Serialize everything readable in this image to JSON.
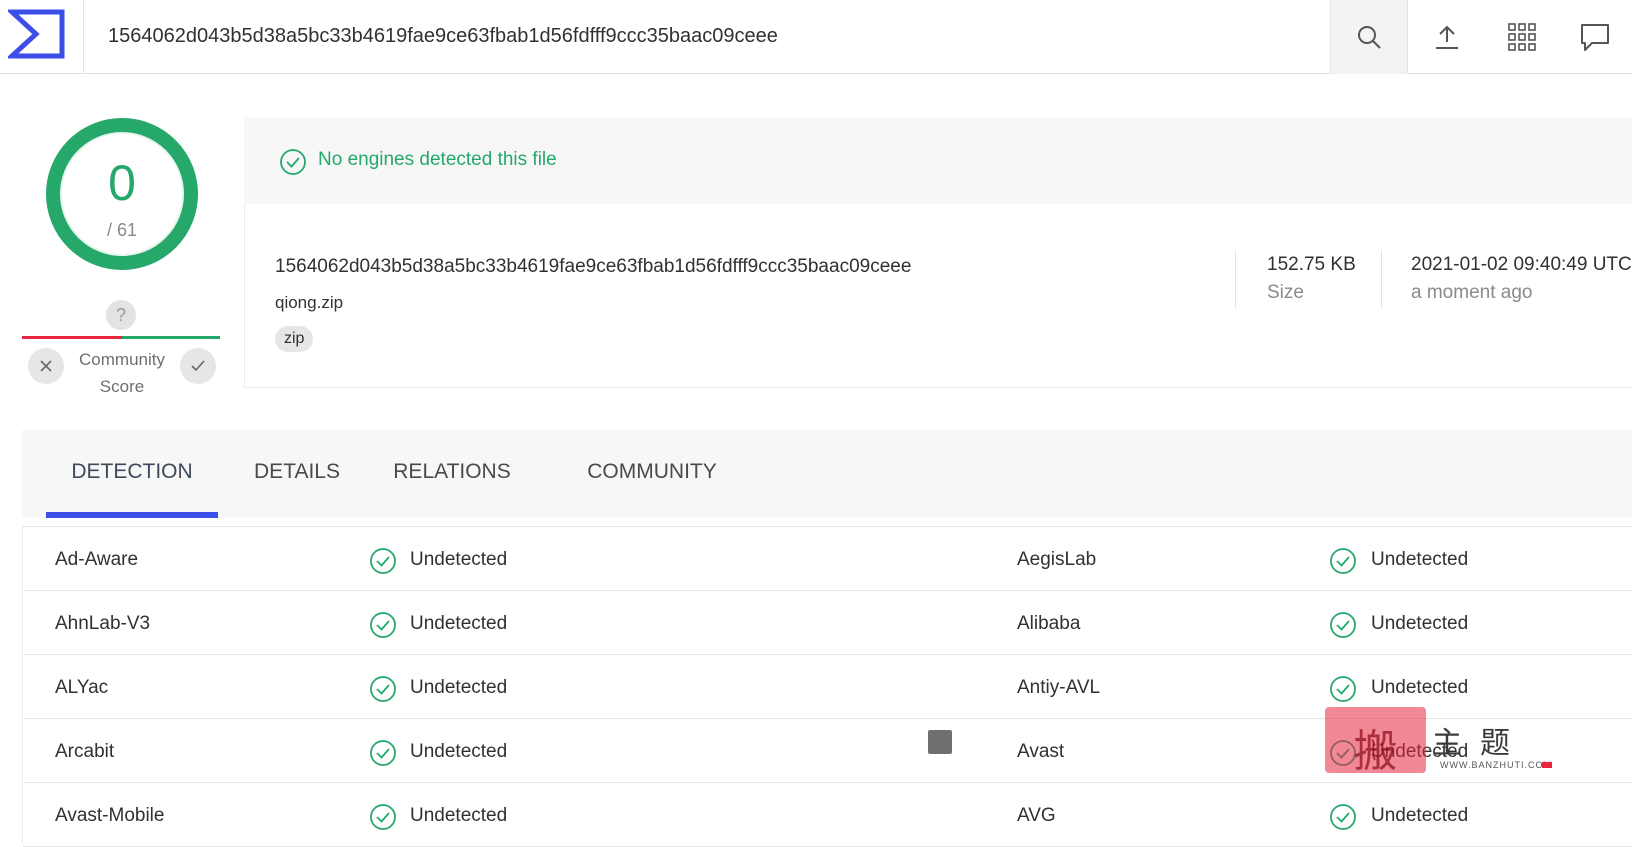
{
  "search": {
    "query": "1564062d043b5d38a5bc33b4619fae9ce63fbab1d56fdfff9ccc35baac09ceee"
  },
  "toolbar": {
    "search_icon": "search-icon",
    "upload_icon": "upload-icon",
    "apps_icon": "apps-grid-icon",
    "chat_icon": "chat-icon"
  },
  "score": {
    "detected": "0",
    "total": "/ 61"
  },
  "community": {
    "question": "?",
    "label_line1": "Community",
    "label_line2": "Score"
  },
  "banner": {
    "text": "No engines detected this file"
  },
  "file": {
    "hash": "1564062d043b5d38a5bc33b4619fae9ce63fbab1d56fdfff9ccc35baac09ceee",
    "name": "qiong.zip",
    "tag": "zip",
    "size": "152.75 KB",
    "size_label": "Size",
    "date": "2021-01-02 09:40:49 UTC",
    "date_relative": "a moment ago"
  },
  "tabs": [
    "DETECTION",
    "DETAILS",
    "RELATIONS",
    "COMMUNITY"
  ],
  "results": [
    {
      "left_engine": "Ad-Aware",
      "left_result": "Undetected",
      "right_engine": "AegisLab",
      "right_result": "Undetected"
    },
    {
      "left_engine": "AhnLab-V3",
      "left_result": "Undetected",
      "right_engine": "Alibaba",
      "right_result": "Undetected"
    },
    {
      "left_engine": "ALYac",
      "left_result": "Undetected",
      "right_engine": "Antiy-AVL",
      "right_result": "Undetected"
    },
    {
      "left_engine": "Arcabit",
      "left_result": "Undetected",
      "right_engine": "Avast",
      "right_result": "Undetected"
    },
    {
      "left_engine": "Avast-Mobile",
      "left_result": "Undetected",
      "right_engine": "AVG",
      "right_result": "Undetected"
    }
  ],
  "watermark": {
    "stamp": "搬",
    "text": "主题",
    "url": "WWW.BANZHUTI.COM"
  },
  "colors": {
    "green": "#26a86b",
    "red": "#e8253f",
    "blue": "#3b4ee8"
  }
}
